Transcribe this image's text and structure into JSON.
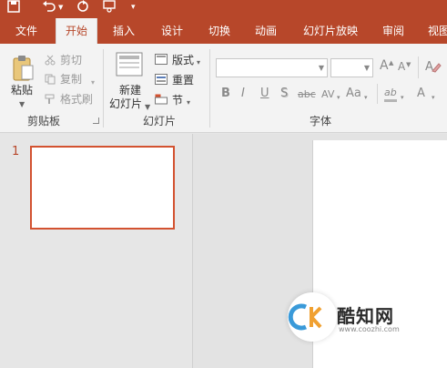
{
  "quick_access": {
    "save_icon": "save-icon",
    "undo_icon": "undo-icon",
    "redo_icon": "redo-icon",
    "start_presentation_icon": "start-presentation-icon",
    "customize_icon": "customize-icon"
  },
  "tabs": [
    "文件",
    "开始",
    "插入",
    "设计",
    "切换",
    "动画",
    "幻灯片放映",
    "审阅",
    "视图"
  ],
  "active_tab": "开始",
  "ribbon": {
    "clipboard": {
      "paste": "粘贴",
      "cut": "剪切",
      "copy": "复制",
      "format_painter": "格式刷",
      "group_label": "剪贴板"
    },
    "slides": {
      "new_slide_line1": "新建",
      "new_slide_line2": "幻灯片",
      "layout": "版式",
      "reset": "重置",
      "section": "节",
      "group_label": "幻灯片"
    },
    "font": {
      "font_name_value": "",
      "font_size_value": "",
      "grow_font": "A",
      "shrink_font": "A",
      "clear_formatting_icon": "clear-formatting-icon",
      "bold": "B",
      "italic": "I",
      "underline": "U",
      "shadow": "S",
      "strikethrough": "abc",
      "char_spacing": "AV",
      "change_case": "Aa",
      "highlight": "ab",
      "font_color": "A",
      "group_label": "字体"
    }
  },
  "thumbnails": {
    "slide_number": "1"
  },
  "watermark": {
    "name": "酷知网",
    "url": "www.coozhi.com"
  },
  "colors": {
    "accent": "#b7472a",
    "thumb_border": "#d35230",
    "ribbon_bg": "#f3f3f3",
    "pane_bg": "#e6e6e6"
  }
}
